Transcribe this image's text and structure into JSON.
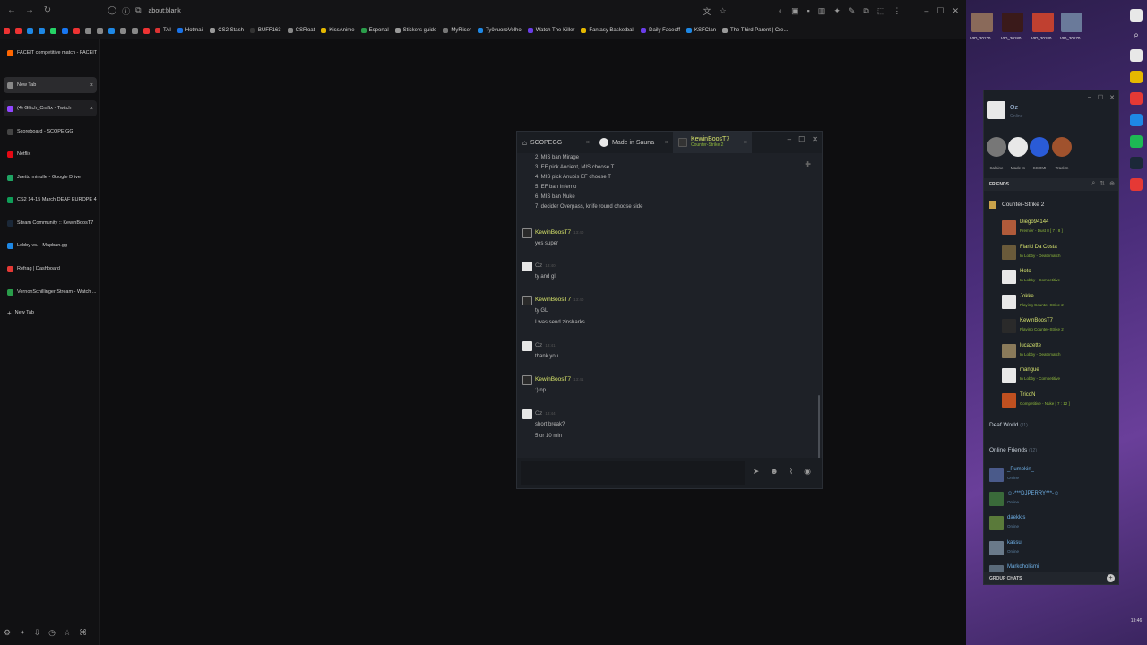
{
  "browser": {
    "url": "about:blank",
    "bookmarks": [
      {
        "label": "TAI",
        "color": "#d33"
      },
      {
        "label": "Hotmail",
        "color": "#1a73e8"
      },
      {
        "label": "CS2 Stash",
        "color": "#999"
      },
      {
        "label": "BUFF163",
        "color": "#333"
      },
      {
        "label": "CSFloat",
        "color": "#888"
      },
      {
        "label": "KissAnime",
        "color": "#e5b800"
      },
      {
        "label": "Esportal",
        "color": "#2a9d4a"
      },
      {
        "label": "Stickers guide",
        "color": "#999"
      },
      {
        "label": "MyFliser",
        "color": "#777"
      },
      {
        "label": "TyövuoroVelho",
        "color": "#1e88e5"
      },
      {
        "label": "Watch The Killer",
        "color": "#6a3de8"
      },
      {
        "label": "Fantasy Basketball",
        "color": "#e5b800"
      },
      {
        "label": "Daily Faceoff",
        "color": "#6a3de8"
      },
      {
        "label": "KSFClan",
        "color": "#1e88e5"
      },
      {
        "label": "The Third Parent | Cre...",
        "color": "#999"
      }
    ]
  },
  "sidebar": {
    "tabs": [
      {
        "label": "FACEIT competitive match - FACEIT",
        "color": "#f60",
        "state": "normal",
        "close": ""
      },
      {
        "label": "New Tab",
        "color": "#888",
        "state": "active",
        "close": "×"
      },
      {
        "label": "(4) Glitch_Craftx - Twitch",
        "color": "#9146ff",
        "state": "hover",
        "close": "×"
      },
      {
        "label": "Scoreboard - SCOPE.GG",
        "color": "#444",
        "state": "normal",
        "close": ""
      },
      {
        "label": "Netflix",
        "color": "#e50914",
        "state": "normal",
        "close": ""
      },
      {
        "label": "Jaettu minulle - Google Drive",
        "color": "#1fa463",
        "state": "normal",
        "close": ""
      },
      {
        "label": "CS2 14-15 March DEAF EUROPE 4...",
        "color": "#0f9d58",
        "state": "normal",
        "close": ""
      },
      {
        "label": "Steam Community :: KewinBoosT7",
        "color": "#1b2838",
        "state": "normal",
        "close": ""
      },
      {
        "label": "Lobby vs. - Mapban.gg",
        "color": "#1e88e5",
        "state": "normal",
        "close": ""
      },
      {
        "label": "Refrag | Dashboard",
        "color": "#e53935",
        "state": "normal",
        "close": ""
      },
      {
        "label": "VernonSchillinger Stream - Watch ...",
        "color": "#2a9d4a",
        "state": "normal",
        "close": ""
      },
      {
        "label": "New Tab",
        "color": "#888",
        "state": "normal",
        "close": "",
        "plus": true
      }
    ]
  },
  "chat": {
    "tabs": [
      {
        "label": "SCOPEGG",
        "sub": "",
        "close": "×"
      },
      {
        "label": "Made in Sauna",
        "sub": "",
        "close": "×"
      },
      {
        "label": "KewinBoosT7",
        "sub": "Counter-Strike 2",
        "close": "×"
      }
    ],
    "top_lines": [
      "2. MIS ban Mirage",
      "3. EF pick Ancient, MIS choose T",
      "4. MIS pick Anubis EF choose T",
      "5. EF ban Inferno",
      "6. MIS ban Nuke",
      "7. decider Overpass, knife round choose side"
    ],
    "messages": [
      {
        "author": "KewinBoosT7",
        "kind": "kb",
        "time": "13:40",
        "lines": [
          "yes super"
        ]
      },
      {
        "author": "Oz",
        "kind": "oz",
        "time": "13:40",
        "lines": [
          "ty and gl"
        ]
      },
      {
        "author": "KewinBoosT7",
        "kind": "kb",
        "time": "13:40",
        "lines": [
          "ty GL",
          "I was send zinsharks"
        ]
      },
      {
        "author": "Oz",
        "kind": "oz",
        "time": "13:41",
        "lines": [
          "thank you"
        ]
      },
      {
        "author": "KewinBoosT7",
        "kind": "kb",
        "time": "13:41",
        "lines": [
          ":) np"
        ]
      },
      {
        "author": "Oz",
        "kind": "oz",
        "time": "13:44",
        "lines": [
          "short break?",
          "5 or 10 min"
        ]
      }
    ],
    "input_value": ""
  },
  "friends": {
    "user_name": "Oz",
    "user_status": "Online",
    "recent": [
      {
        "label": "Salaine",
        "color": "#777"
      },
      {
        "label": "Made In",
        "color": "#e8e8e8"
      },
      {
        "label": "SCOMI",
        "color": "#2a5bd7"
      },
      {
        "label": "Trackm",
        "color": "#a0522d"
      }
    ],
    "bar_label": "FRIENDS",
    "category": "Counter-Strike 2",
    "ingame": [
      {
        "name": "Diego94144",
        "status": "Premier - Dust II [ 7 : 8 ]",
        "color": "#b05a3a"
      },
      {
        "name": "Flarid Da Costa",
        "status": "In Lobby - Deathmatch",
        "color": "#6a5a3a"
      },
      {
        "name": "Hoto",
        "status": "In Lobby - Competitive",
        "color": "#e8e8e8"
      },
      {
        "name": "Jokke",
        "status": "Playing Counter-Strike 2",
        "color": "#e8e8e8"
      },
      {
        "name": "KewinBoosT7",
        "status": "Playing Counter-Strike 2",
        "color": "#2a2a2a"
      },
      {
        "name": "lucazette",
        "status": "In Lobby - Deathmatch",
        "color": "#8a7a5a"
      },
      {
        "name": "mangue",
        "status": "In Lobby - Competitive",
        "color": "#e8e8e8"
      },
      {
        "name": "TricoN",
        "status": "Competitive - Nuke [ 7 : 12 ]",
        "color": "#c05020"
      }
    ],
    "groups": [
      {
        "label": "Deaf World",
        "count": "(11)"
      },
      {
        "label": "Online Friends",
        "count": "(12)"
      }
    ],
    "online": [
      {
        "name": "_Pumpkin_",
        "status": "Online",
        "color": "#4a5a8a"
      },
      {
        "name": "☺-***DJPERRY***-☺",
        "status": "Online",
        "color": "#3a6a3a"
      },
      {
        "name": "daekkis",
        "status": "Online",
        "color": "#5a7a3a"
      },
      {
        "name": "kassu",
        "status": "Online",
        "color": "#6a7a8a"
      },
      {
        "name": "Markoholismi",
        "status": "",
        "color": "#5a6a7a"
      }
    ],
    "group_chats_label": "GROUP CHATS"
  },
  "desktop": {
    "icons": [
      {
        "label": "VID_20170...",
        "color": "#8a6a5a"
      },
      {
        "label": "VID_20180...",
        "color": "#3a1a1a"
      },
      {
        "label": "VID_20180...",
        "color": "#c04030"
      },
      {
        "label": "VID_20170...",
        "color": "#6a7a9a"
      }
    ],
    "time": "13:46"
  }
}
